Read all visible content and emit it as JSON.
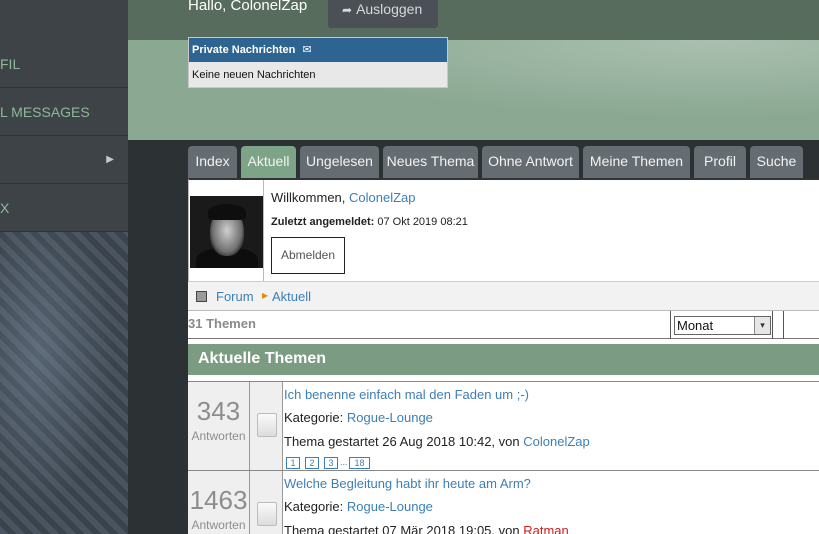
{
  "sidebar": {
    "items": [
      {
        "label": "FIL"
      },
      {
        "label": "L MESSAGES"
      },
      {
        "label": "",
        "chevron": "▶"
      },
      {
        "label": "X"
      }
    ]
  },
  "header": {
    "greeting": "Hallo, ColonelZap",
    "logout_label": "Ausloggen",
    "logout_icon": "logout-icon"
  },
  "private_messages": {
    "title": "Private Nachrichten",
    "icon": "mail-icon",
    "body": "Keine neuen Nachrichten"
  },
  "tabs": [
    {
      "label": "Index",
      "active": false
    },
    {
      "label": "Aktuell",
      "active": true
    },
    {
      "label": "Ungelesen",
      "active": false
    },
    {
      "label": "Neues Thema",
      "active": false
    },
    {
      "label": "Ohne Antwort",
      "active": false
    },
    {
      "label": "Meine Themen",
      "active": false
    },
    {
      "label": "Profil",
      "active": false
    },
    {
      "label": "Suche",
      "active": false
    }
  ],
  "welcome": {
    "prefix": "Willkommen,",
    "username": "ColonelZap",
    "last_login_label": "Zuletzt angemeldet:",
    "last_login_value": "07 Okt 2019 08:21",
    "logout_button": "Abmelden"
  },
  "breadcrumb": {
    "forum": "Forum",
    "current": "Aktuell"
  },
  "topic_count": "31 Themen",
  "period_select": {
    "value": "Monat",
    "arrow": "▾"
  },
  "section_title": "Aktuelle Themen",
  "topics": [
    {
      "replies": "343",
      "replies_label": "Antworten",
      "title": "Ich benenne einfach mal den Faden um ;-)",
      "category_label": "Kategorie:",
      "category": "Rogue-Lounge",
      "started_text": "Thema gestartet 26 Aug 2018 10:42, von",
      "author": "ColonelZap",
      "pages": [
        "1",
        "2",
        "3",
        "...",
        "18"
      ]
    },
    {
      "replies": "1463",
      "replies_label": "Antworten",
      "title": "Welche Begleitung habt ihr heute am Arm?",
      "category_label": "Kategorie:",
      "category": "Rogue-Lounge",
      "started_text": "Thema gestartet 07 Mär 2018 19:05, von",
      "author": "Ratman"
    }
  ],
  "colors": {
    "accent_green": "#7da487",
    "link_blue": "#3c7fb8",
    "pm_header_blue": "#2e6491",
    "author_red": "#cc1f1f"
  }
}
